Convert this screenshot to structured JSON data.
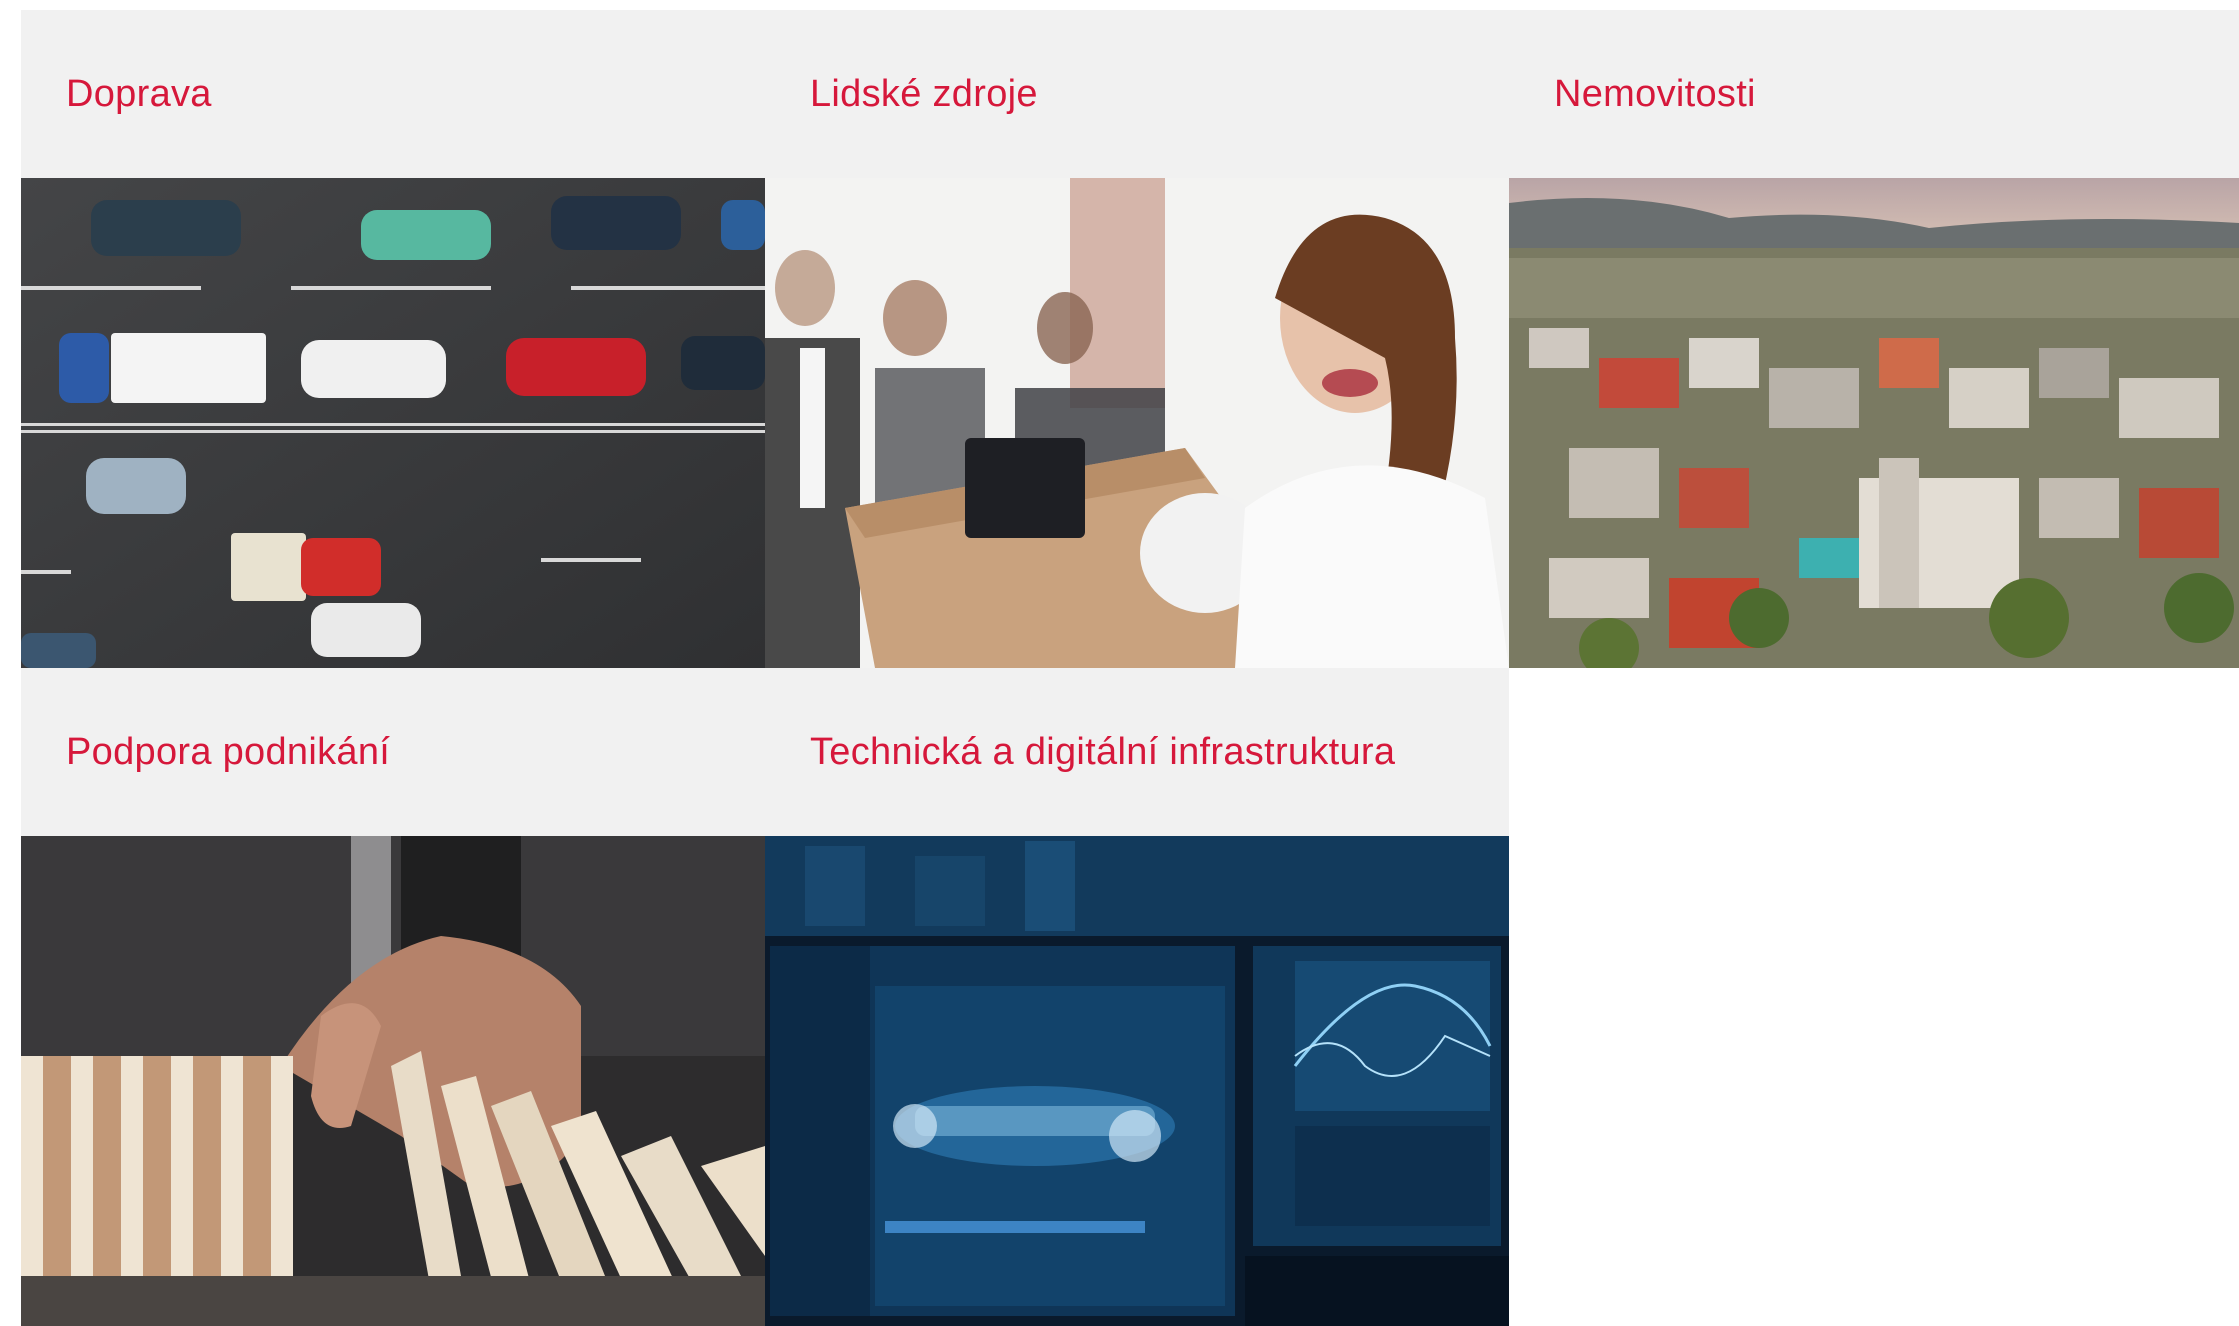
{
  "cards": [
    {
      "title": "Doprava",
      "image": "traffic-aerial-photo"
    },
    {
      "title": "Lidské zdroje",
      "image": "office-employee-photo"
    },
    {
      "title": "Nemovitosti",
      "image": "city-aerial-photo"
    },
    {
      "title": "Podpora podnikání",
      "image": "domino-hand-photo"
    },
    {
      "title": "Technická a digitální infrastruktura",
      "image": "digital-monitors-photo"
    }
  ],
  "colors": {
    "title_accent": "#d6183b",
    "header_background": "#f1f1f1"
  }
}
